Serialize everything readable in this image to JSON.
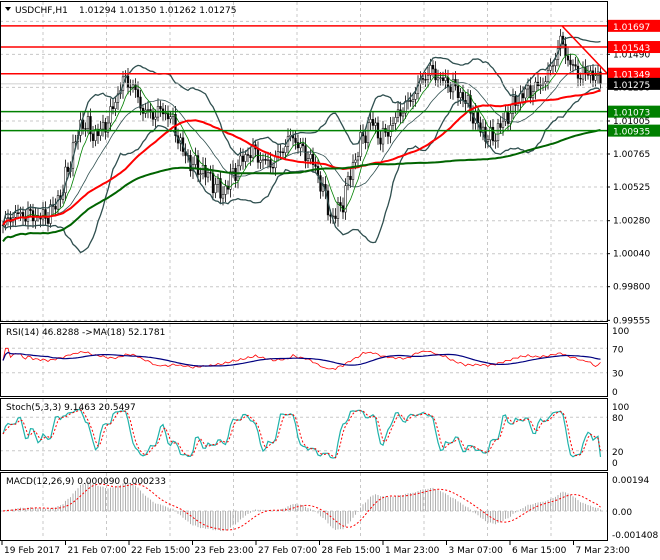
{
  "header": {
    "symbol": "USDCHF,H1",
    "ohlc": "1.01294 1.01350 1.01262 1.01275"
  },
  "chart_data": [
    {
      "type": "candlestick",
      "title": "USDCHF,H1 1.01294 1.01350 1.01262 1.01275",
      "ylim": [
        0.99555,
        1.0173
      ],
      "yticks": [
        "1.01730",
        "1.01490",
        "1.01250",
        "1.01005",
        "1.00765",
        "1.00525",
        "1.00280",
        "1.00040",
        "0.99800",
        "0.99555"
      ],
      "xticks": [
        "19 Feb 2017",
        "21 Feb 07:00",
        "22 Feb 15:00",
        "23 Feb 23:00",
        "27 Feb 07:00",
        "28 Feb 15:00",
        "1 Mar 23:00",
        "3 Mar 07:00",
        "6 Mar 15:00",
        "7 Mar 23:00"
      ],
      "grid": true,
      "close": [
        1.00249,
        1.00321,
        1.00321,
        1.00321,
        1.003,
        1.00358,
        1.00503,
        1.00794,
        1.01012,
        1.00903,
        1.00939,
        1.01085,
        1.01303,
        1.01267,
        1.01085,
        1.01049,
        1.01085,
        1.01012,
        1.00794,
        1.00685,
        1.00649,
        1.00576,
        1.00467,
        1.00612,
        1.00721,
        1.00794,
        1.00721,
        1.00685,
        1.00794,
        1.00903,
        1.00794,
        1.00721,
        1.0054,
        1.00285,
        1.00394,
        1.00649,
        1.00867,
        1.01012,
        1.00867,
        1.00976,
        1.01085,
        1.01158,
        1.01303,
        1.01376,
        1.01303,
        1.01267,
        1.01194,
        1.01085,
        1.00939,
        1.00867,
        1.00976,
        1.01085,
        1.01194,
        1.0123,
        1.01267,
        1.01376,
        1.01594,
        1.01412,
        1.01339,
        1.01361,
        1.01275
      ],
      "resistance_levels": [
        {
          "label": "1.01697",
          "value": 1.01697,
          "color": "#ff0000"
        },
        {
          "label": "1.01543",
          "value": 1.01543,
          "color": "#ff0000"
        },
        {
          "label": "1.01349",
          "value": 1.01349,
          "color": "#ff0000"
        }
      ],
      "support_levels": [
        {
          "label": "1.01073",
          "value": 1.01073,
          "color": "#008000"
        },
        {
          "label": "1.00935",
          "value": 1.00935,
          "color": "#008000"
        }
      ],
      "current_price": {
        "label": "1.01275",
        "value": 1.01275,
        "color": "#000000"
      },
      "trendline": {
        "from": 1.01697,
        "to": 1.01349,
        "color": "#ff0000"
      },
      "indicators": [
        "Bollinger Bands",
        "Moving Averages"
      ]
    },
    {
      "type": "line",
      "title": "RSI(14) 46.8288  ->MA(18) 52.1781",
      "ylim": [
        0,
        100
      ],
      "yticks": [
        "100",
        "70",
        "30",
        "0"
      ],
      "series": [
        {
          "name": "RSI(14)",
          "last": 46.8288,
          "color": "#ff0000"
        },
        {
          "name": "MA(18)",
          "last": 52.1781,
          "color": "#000080"
        }
      ]
    },
    {
      "type": "line",
      "title": "Stoch(5,3,3) 9.1463 20.5497",
      "ylim": [
        0,
        100
      ],
      "yticks": [
        "100",
        "80",
        "20",
        "0"
      ],
      "series": [
        {
          "name": "main",
          "last": 9.1463,
          "color": "#20b2aa"
        },
        {
          "name": "signal",
          "last": 20.5497,
          "color": "#ff0000"
        }
      ]
    },
    {
      "type": "bar",
      "title": "MACD(12,26,9) 0.000090 0.000233",
      "ylim": [
        -0.001408,
        0.00194
      ],
      "yticks": [
        "0.00194",
        "0.00",
        "-0.001408"
      ],
      "series": [
        {
          "name": "MACD",
          "last": 9e-05,
          "color": "#c0c0c0"
        },
        {
          "name": "signal",
          "last": 0.000233,
          "color": "#ff0000"
        }
      ]
    }
  ]
}
